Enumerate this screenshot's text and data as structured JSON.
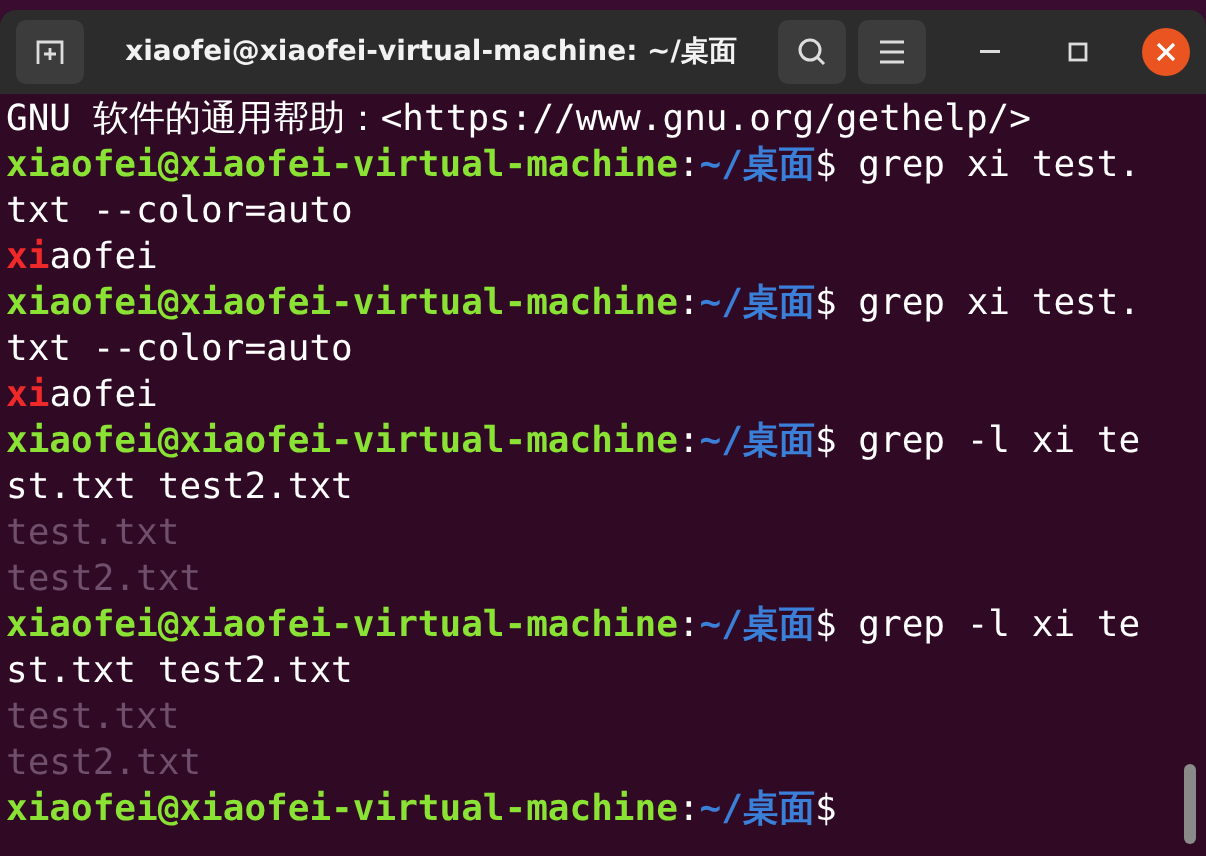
{
  "window": {
    "title": "xiaofei@xiaofei-virtual-machine: ~/桌面"
  },
  "terminal": {
    "lines": [
      [
        {
          "kind": "text",
          "text": "GNU 软件的通用帮助：<https://www.gnu.org/gethelp/>"
        }
      ],
      [
        {
          "kind": "user",
          "text": "xiaofei@xiaofei-virtual-machine"
        },
        {
          "kind": "text",
          "text": ":"
        },
        {
          "kind": "path",
          "text": "~/桌面"
        },
        {
          "kind": "text",
          "text": "$ grep xi test."
        }
      ],
      [
        {
          "kind": "text",
          "text": "txt --color=auto"
        }
      ],
      [
        {
          "kind": "match",
          "text": "xi"
        },
        {
          "kind": "text",
          "text": "aofei"
        }
      ],
      [
        {
          "kind": "user",
          "text": "xiaofei@xiaofei-virtual-machine"
        },
        {
          "kind": "text",
          "text": ":"
        },
        {
          "kind": "path",
          "text": "~/桌面"
        },
        {
          "kind": "text",
          "text": "$ grep xi test."
        }
      ],
      [
        {
          "kind": "text",
          "text": "txt --color=auto"
        }
      ],
      [
        {
          "kind": "match",
          "text": "xi"
        },
        {
          "kind": "text",
          "text": "aofei"
        }
      ],
      [
        {
          "kind": "user",
          "text": "xiaofei@xiaofei-virtual-machine"
        },
        {
          "kind": "text",
          "text": ":"
        },
        {
          "kind": "path",
          "text": "~/桌面"
        },
        {
          "kind": "text",
          "text": "$ grep -l xi te"
        }
      ],
      [
        {
          "kind": "text",
          "text": "st.txt test2.txt"
        }
      ],
      [
        {
          "kind": "dim",
          "text": "test.txt"
        }
      ],
      [
        {
          "kind": "dim",
          "text": "test2.txt"
        }
      ],
      [
        {
          "kind": "user",
          "text": "xiaofei@xiaofei-virtual-machine"
        },
        {
          "kind": "text",
          "text": ":"
        },
        {
          "kind": "path",
          "text": "~/桌面"
        },
        {
          "kind": "text",
          "text": "$ grep -l xi te"
        }
      ],
      [
        {
          "kind": "text",
          "text": "st.txt test2.txt"
        }
      ],
      [
        {
          "kind": "dim",
          "text": "test.txt"
        }
      ],
      [
        {
          "kind": "dim",
          "text": "test2.txt"
        }
      ],
      [
        {
          "kind": "user",
          "text": "xiaofei@xiaofei-virtual-machine"
        },
        {
          "kind": "text",
          "text": ":"
        },
        {
          "kind": "path",
          "text": "~/桌面"
        },
        {
          "kind": "text",
          "text": "$"
        }
      ]
    ]
  }
}
